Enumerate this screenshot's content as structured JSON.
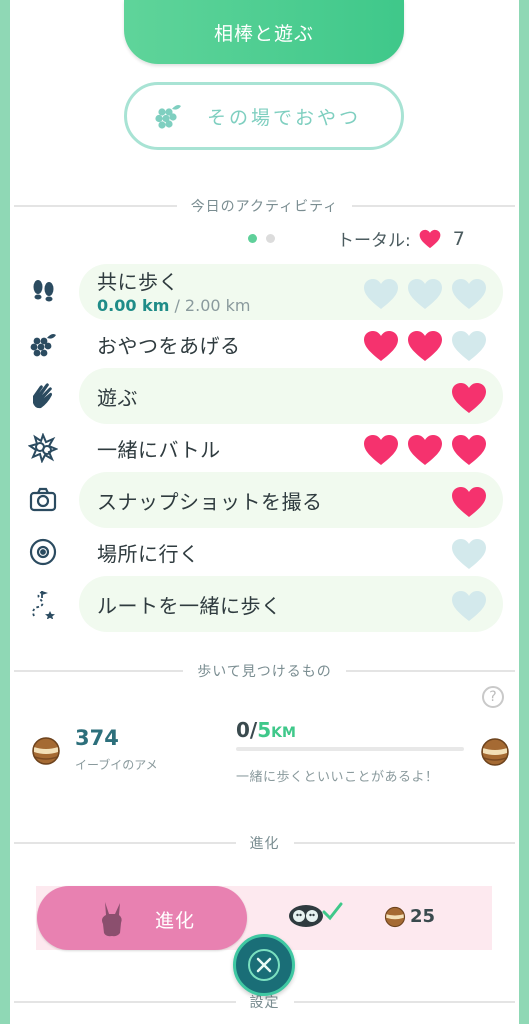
{
  "buttons": {
    "play_with_buddy": "相棒と遊ぶ",
    "snack": "その場でおやつ"
  },
  "activities_section": {
    "title": "今日のアクティビティ",
    "pager": {
      "pages": 2,
      "current": 1
    },
    "total_label": "トータル:",
    "total_value": "7",
    "items": [
      {
        "label": "共に歩く",
        "icon": "footprints-icon",
        "sub_current": "0.00 km",
        "sub_goal": " / 2.00 km",
        "hearts_filled": 0,
        "hearts_total": 3,
        "highlight": true
      },
      {
        "label": "おやつをあげる",
        "icon": "berry-icon",
        "hearts_filled": 2,
        "hearts_total": 3,
        "highlight": false
      },
      {
        "label": "遊ぶ",
        "icon": "wave-hand-icon",
        "hearts_filled": 1,
        "hearts_total": 1,
        "highlight": true
      },
      {
        "label": "一緒にバトル",
        "icon": "battle-icon",
        "hearts_filled": 3,
        "hearts_total": 3,
        "highlight": false
      },
      {
        "label": "スナップショットを撮る",
        "icon": "camera-icon",
        "hearts_filled": 1,
        "hearts_total": 1,
        "highlight": true
      },
      {
        "label": "場所に行く",
        "icon": "pokestop-icon",
        "hearts_filled": 0,
        "hearts_total": 1,
        "highlight": false
      },
      {
        "label": "ルートを一緒に歩く",
        "icon": "route-icon",
        "hearts_filled": 0,
        "hearts_total": 1,
        "highlight": true
      }
    ]
  },
  "walk_section": {
    "title": "歩いて見つけるもの",
    "candy_count": "374",
    "candy_name": "イーブイのアメ",
    "distance_current": "0",
    "distance_slash": "/",
    "distance_goal": "5",
    "distance_unit": "KM",
    "progress_fraction": 0,
    "message": "一緒に歩くといいことがあるよ！",
    "help_icon": "?"
  },
  "evolve_section": {
    "title": "進化",
    "button_label": "進化",
    "candy_cost": "25"
  },
  "settings_label": "設定",
  "colors": {
    "accent_green": "#3fc88a",
    "heart_filled": "#f5326e",
    "heart_empty": "#d3e9ec",
    "evolve_pink": "#e881b1"
  }
}
